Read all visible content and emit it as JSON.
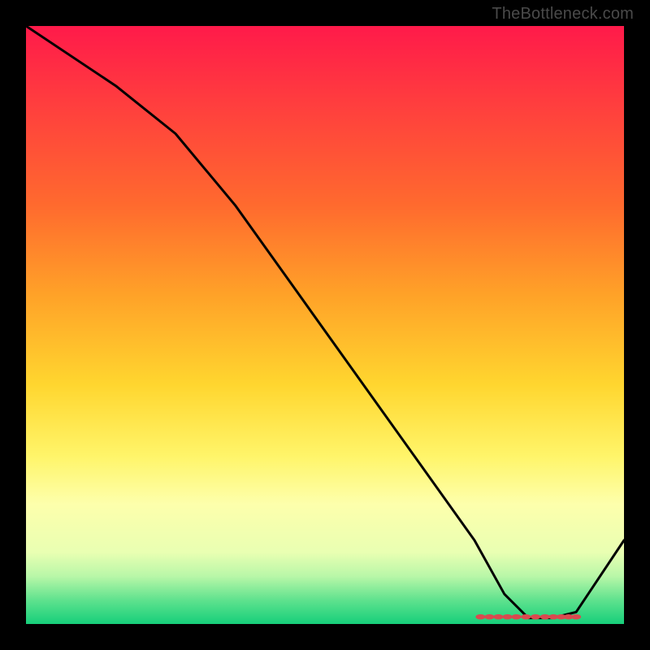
{
  "watermark": "TheBottleneck.com",
  "chart_data": {
    "type": "line",
    "title": "",
    "xlabel": "",
    "ylabel": "",
    "xlim": [
      0,
      100
    ],
    "ylim": [
      0,
      100
    ],
    "x": [
      0,
      15,
      25,
      35,
      45,
      55,
      65,
      75,
      80,
      84,
      88,
      92,
      100
    ],
    "values": [
      100,
      90,
      82,
      70,
      56,
      42,
      28,
      14,
      5,
      1,
      1,
      2,
      14
    ],
    "flat_zone": {
      "x_start": 78,
      "x_end": 90,
      "y": 1
    },
    "marker_cluster": {
      "y": 1.2,
      "xs": [
        76,
        77.5,
        79,
        80.5,
        82,
        83.6,
        85.2,
        86.8,
        88.2,
        89.5,
        90.7,
        92
      ]
    },
    "gradient_stops": [
      {
        "pos": 0.0,
        "color": "#ff1a4a"
      },
      {
        "pos": 0.45,
        "color": "#ffa228"
      },
      {
        "pos": 0.72,
        "color": "#fff56a"
      },
      {
        "pos": 0.92,
        "color": "#b9f7a8"
      },
      {
        "pos": 1.0,
        "color": "#16cf7a"
      }
    ]
  }
}
